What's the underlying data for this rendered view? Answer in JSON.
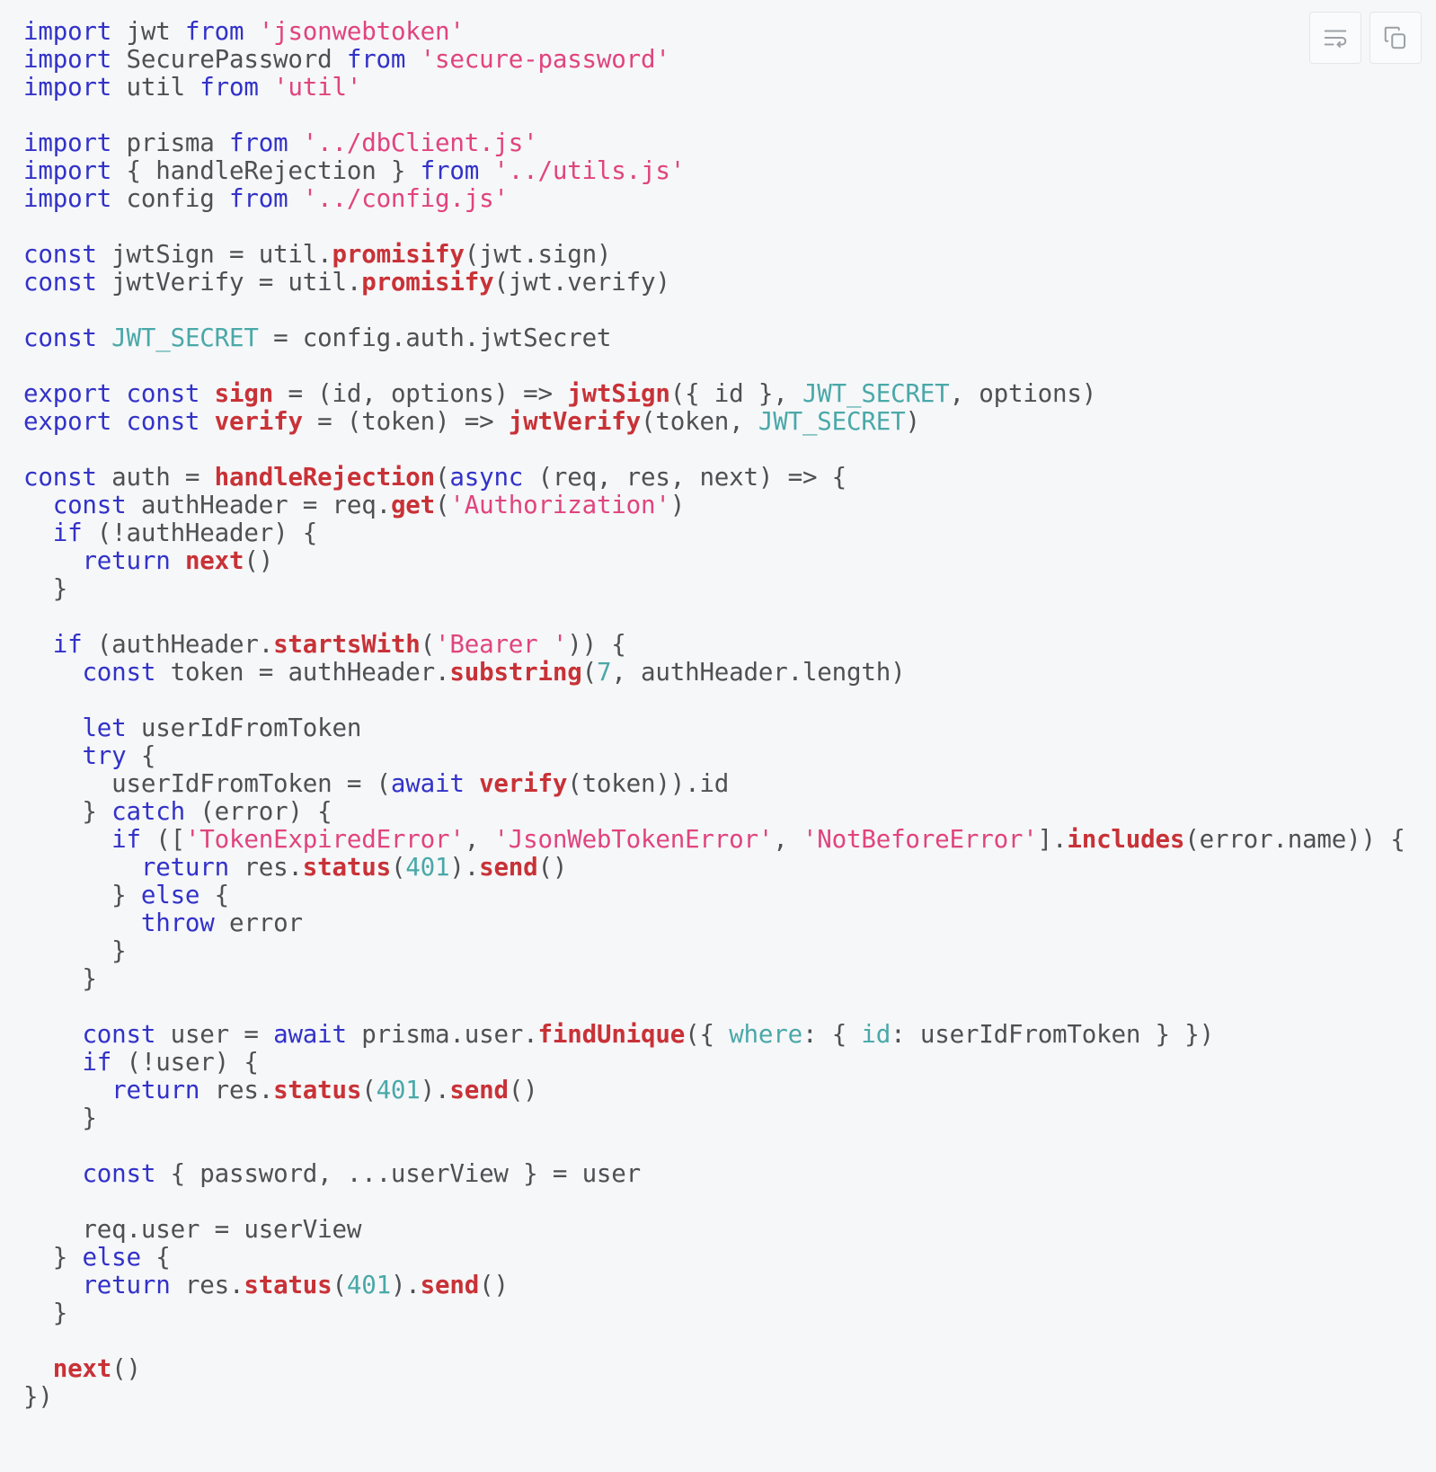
{
  "window": {
    "background_color": "#f6f7f9",
    "language": "javascript"
  },
  "toolbar": {
    "buttons": [
      {
        "name": "toggle-word-wrap",
        "icon": "word-wrap-icon",
        "label": "Toggle word wrap"
      },
      {
        "name": "copy-code",
        "icon": "copy-icon",
        "label": "Copy code"
      }
    ]
  },
  "colors": {
    "background": "#f6f7f9",
    "plain_text": "#4f5054",
    "keyword": "#3232c8",
    "string": "#e0447e",
    "function": "#c83237",
    "constant": "#4aa8a8",
    "button_border": "#e4e6ea",
    "icon": "#9aa0a6"
  },
  "code": {
    "lines": [
      [
        {
          "t": "import",
          "c": "kw"
        },
        {
          "t": " jwt ",
          "c": "pl"
        },
        {
          "t": "from",
          "c": "kw"
        },
        {
          "t": " ",
          "c": "pl"
        },
        {
          "t": "'jsonwebtoken'",
          "c": "str"
        }
      ],
      [
        {
          "t": "import",
          "c": "kw"
        },
        {
          "t": " SecurePassword ",
          "c": "pl"
        },
        {
          "t": "from",
          "c": "kw"
        },
        {
          "t": " ",
          "c": "pl"
        },
        {
          "t": "'secure-password'",
          "c": "str"
        }
      ],
      [
        {
          "t": "import",
          "c": "kw"
        },
        {
          "t": " util ",
          "c": "pl"
        },
        {
          "t": "from",
          "c": "kw"
        },
        {
          "t": " ",
          "c": "pl"
        },
        {
          "t": "'util'",
          "c": "str"
        }
      ],
      [],
      [
        {
          "t": "import",
          "c": "kw"
        },
        {
          "t": " prisma ",
          "c": "pl"
        },
        {
          "t": "from",
          "c": "kw"
        },
        {
          "t": " ",
          "c": "pl"
        },
        {
          "t": "'../dbClient.js'",
          "c": "str"
        }
      ],
      [
        {
          "t": "import",
          "c": "kw"
        },
        {
          "t": " { handleRejection } ",
          "c": "pl"
        },
        {
          "t": "from",
          "c": "kw"
        },
        {
          "t": " ",
          "c": "pl"
        },
        {
          "t": "'../utils.js'",
          "c": "str"
        }
      ],
      [
        {
          "t": "import",
          "c": "kw"
        },
        {
          "t": " config ",
          "c": "pl"
        },
        {
          "t": "from",
          "c": "kw"
        },
        {
          "t": " ",
          "c": "pl"
        },
        {
          "t": "'../config.js'",
          "c": "str"
        }
      ],
      [],
      [
        {
          "t": "const",
          "c": "kw"
        },
        {
          "t": " jwtSign = util.",
          "c": "pl"
        },
        {
          "t": "promisify",
          "c": "fn"
        },
        {
          "t": "(jwt.sign)",
          "c": "pl"
        }
      ],
      [
        {
          "t": "const",
          "c": "kw"
        },
        {
          "t": " jwtVerify = util.",
          "c": "pl"
        },
        {
          "t": "promisify",
          "c": "fn"
        },
        {
          "t": "(jwt.verify)",
          "c": "pl"
        }
      ],
      [],
      [
        {
          "t": "const",
          "c": "kw"
        },
        {
          "t": " ",
          "c": "pl"
        },
        {
          "t": "JWT_SECRET",
          "c": "cls"
        },
        {
          "t": " = config.auth.jwtSecret",
          "c": "pl"
        }
      ],
      [],
      [
        {
          "t": "export",
          "c": "kw"
        },
        {
          "t": " ",
          "c": "pl"
        },
        {
          "t": "const",
          "c": "kw"
        },
        {
          "t": " ",
          "c": "pl"
        },
        {
          "t": "sign",
          "c": "fn"
        },
        {
          "t": " = (id, options) => ",
          "c": "pl"
        },
        {
          "t": "jwtSign",
          "c": "fn"
        },
        {
          "t": "({ id }, ",
          "c": "pl"
        },
        {
          "t": "JWT_SECRET",
          "c": "cls"
        },
        {
          "t": ", options)",
          "c": "pl"
        }
      ],
      [
        {
          "t": "export",
          "c": "kw"
        },
        {
          "t": " ",
          "c": "pl"
        },
        {
          "t": "const",
          "c": "kw"
        },
        {
          "t": " ",
          "c": "pl"
        },
        {
          "t": "verify",
          "c": "fn"
        },
        {
          "t": " = (token) => ",
          "c": "pl"
        },
        {
          "t": "jwtVerify",
          "c": "fn"
        },
        {
          "t": "(token, ",
          "c": "pl"
        },
        {
          "t": "JWT_SECRET",
          "c": "cls"
        },
        {
          "t": ")",
          "c": "pl"
        }
      ],
      [],
      [
        {
          "t": "const",
          "c": "kw"
        },
        {
          "t": " auth = ",
          "c": "pl"
        },
        {
          "t": "handleRejection",
          "c": "fn"
        },
        {
          "t": "(",
          "c": "pl"
        },
        {
          "t": "async",
          "c": "kw"
        },
        {
          "t": " (req, res, next) => {",
          "c": "pl"
        }
      ],
      [
        {
          "t": "  ",
          "c": "pl"
        },
        {
          "t": "const",
          "c": "kw"
        },
        {
          "t": " authHeader = req.",
          "c": "pl"
        },
        {
          "t": "get",
          "c": "fn"
        },
        {
          "t": "(",
          "c": "pl"
        },
        {
          "t": "'Authorization'",
          "c": "str"
        },
        {
          "t": ")",
          "c": "pl"
        }
      ],
      [
        {
          "t": "  ",
          "c": "pl"
        },
        {
          "t": "if",
          "c": "kw"
        },
        {
          "t": " (!authHeader) {",
          "c": "pl"
        }
      ],
      [
        {
          "t": "    ",
          "c": "pl"
        },
        {
          "t": "return",
          "c": "kw"
        },
        {
          "t": " ",
          "c": "pl"
        },
        {
          "t": "next",
          "c": "fn"
        },
        {
          "t": "()",
          "c": "pl"
        }
      ],
      [
        {
          "t": "  }",
          "c": "pl"
        }
      ],
      [],
      [
        {
          "t": "  ",
          "c": "pl"
        },
        {
          "t": "if",
          "c": "kw"
        },
        {
          "t": " (authHeader.",
          "c": "pl"
        },
        {
          "t": "startsWith",
          "c": "fn"
        },
        {
          "t": "(",
          "c": "pl"
        },
        {
          "t": "'Bearer '",
          "c": "str"
        },
        {
          "t": ")) {",
          "c": "pl"
        }
      ],
      [
        {
          "t": "    ",
          "c": "pl"
        },
        {
          "t": "const",
          "c": "kw"
        },
        {
          "t": " token = authHeader.",
          "c": "pl"
        },
        {
          "t": "substring",
          "c": "fn"
        },
        {
          "t": "(",
          "c": "pl"
        },
        {
          "t": "7",
          "c": "cls"
        },
        {
          "t": ", authHeader.length)",
          "c": "pl"
        }
      ],
      [],
      [
        {
          "t": "    ",
          "c": "pl"
        },
        {
          "t": "let",
          "c": "kw"
        },
        {
          "t": " userIdFromToken",
          "c": "pl"
        }
      ],
      [
        {
          "t": "    ",
          "c": "pl"
        },
        {
          "t": "try",
          "c": "kw"
        },
        {
          "t": " {",
          "c": "pl"
        }
      ],
      [
        {
          "t": "      userIdFromToken = (",
          "c": "pl"
        },
        {
          "t": "await",
          "c": "kw"
        },
        {
          "t": " ",
          "c": "pl"
        },
        {
          "t": "verify",
          "c": "fn"
        },
        {
          "t": "(token)).id",
          "c": "pl"
        }
      ],
      [
        {
          "t": "    } ",
          "c": "pl"
        },
        {
          "t": "catch",
          "c": "kw"
        },
        {
          "t": " (error) {",
          "c": "pl"
        }
      ],
      [
        {
          "t": "      ",
          "c": "pl"
        },
        {
          "t": "if",
          "c": "kw"
        },
        {
          "t": " ([",
          "c": "pl"
        },
        {
          "t": "'TokenExpiredError'",
          "c": "str"
        },
        {
          "t": ", ",
          "c": "pl"
        },
        {
          "t": "'JsonWebTokenError'",
          "c": "str"
        },
        {
          "t": ", ",
          "c": "pl"
        },
        {
          "t": "'NotBeforeError'",
          "c": "str"
        },
        {
          "t": "].",
          "c": "pl"
        },
        {
          "t": "includes",
          "c": "fn"
        },
        {
          "t": "(error.name)) {",
          "c": "pl"
        }
      ],
      [
        {
          "t": "        ",
          "c": "pl"
        },
        {
          "t": "return",
          "c": "kw"
        },
        {
          "t": " res.",
          "c": "pl"
        },
        {
          "t": "status",
          "c": "fn"
        },
        {
          "t": "(",
          "c": "pl"
        },
        {
          "t": "401",
          "c": "cls"
        },
        {
          "t": ").",
          "c": "pl"
        },
        {
          "t": "send",
          "c": "fn"
        },
        {
          "t": "()",
          "c": "pl"
        }
      ],
      [
        {
          "t": "      } ",
          "c": "pl"
        },
        {
          "t": "else",
          "c": "kw"
        },
        {
          "t": " {",
          "c": "pl"
        }
      ],
      [
        {
          "t": "        ",
          "c": "pl"
        },
        {
          "t": "throw",
          "c": "kw"
        },
        {
          "t": " error",
          "c": "pl"
        }
      ],
      [
        {
          "t": "      }",
          "c": "pl"
        }
      ],
      [
        {
          "t": "    }",
          "c": "pl"
        }
      ],
      [],
      [
        {
          "t": "    ",
          "c": "pl"
        },
        {
          "t": "const",
          "c": "kw"
        },
        {
          "t": " user = ",
          "c": "pl"
        },
        {
          "t": "await",
          "c": "kw"
        },
        {
          "t": " prisma.user.",
          "c": "pl"
        },
        {
          "t": "findUnique",
          "c": "fn"
        },
        {
          "t": "({ ",
          "c": "pl"
        },
        {
          "t": "where",
          "c": "cls"
        },
        {
          "t": ": { ",
          "c": "pl"
        },
        {
          "t": "id",
          "c": "cls"
        },
        {
          "t": ": userIdFromToken } })",
          "c": "pl"
        }
      ],
      [
        {
          "t": "    ",
          "c": "pl"
        },
        {
          "t": "if",
          "c": "kw"
        },
        {
          "t": " (!user) {",
          "c": "pl"
        }
      ],
      [
        {
          "t": "      ",
          "c": "pl"
        },
        {
          "t": "return",
          "c": "kw"
        },
        {
          "t": " res.",
          "c": "pl"
        },
        {
          "t": "status",
          "c": "fn"
        },
        {
          "t": "(",
          "c": "pl"
        },
        {
          "t": "401",
          "c": "cls"
        },
        {
          "t": ").",
          "c": "pl"
        },
        {
          "t": "send",
          "c": "fn"
        },
        {
          "t": "()",
          "c": "pl"
        }
      ],
      [
        {
          "t": "    }",
          "c": "pl"
        }
      ],
      [],
      [
        {
          "t": "    ",
          "c": "pl"
        },
        {
          "t": "const",
          "c": "kw"
        },
        {
          "t": " { password, ...userView } = user",
          "c": "pl"
        }
      ],
      [],
      [
        {
          "t": "    req.user = userView",
          "c": "pl"
        }
      ],
      [
        {
          "t": "  } ",
          "c": "pl"
        },
        {
          "t": "else",
          "c": "kw"
        },
        {
          "t": " {",
          "c": "pl"
        }
      ],
      [
        {
          "t": "    ",
          "c": "pl"
        },
        {
          "t": "return",
          "c": "kw"
        },
        {
          "t": " res.",
          "c": "pl"
        },
        {
          "t": "status",
          "c": "fn"
        },
        {
          "t": "(",
          "c": "pl"
        },
        {
          "t": "401",
          "c": "cls"
        },
        {
          "t": ").",
          "c": "pl"
        },
        {
          "t": "send",
          "c": "fn"
        },
        {
          "t": "()",
          "c": "pl"
        }
      ],
      [
        {
          "t": "  }",
          "c": "pl"
        }
      ],
      [],
      [
        {
          "t": "  ",
          "c": "pl"
        },
        {
          "t": "next",
          "c": "fn"
        },
        {
          "t": "()",
          "c": "pl"
        }
      ],
      [
        {
          "t": "})",
          "c": "pl"
        }
      ]
    ]
  }
}
